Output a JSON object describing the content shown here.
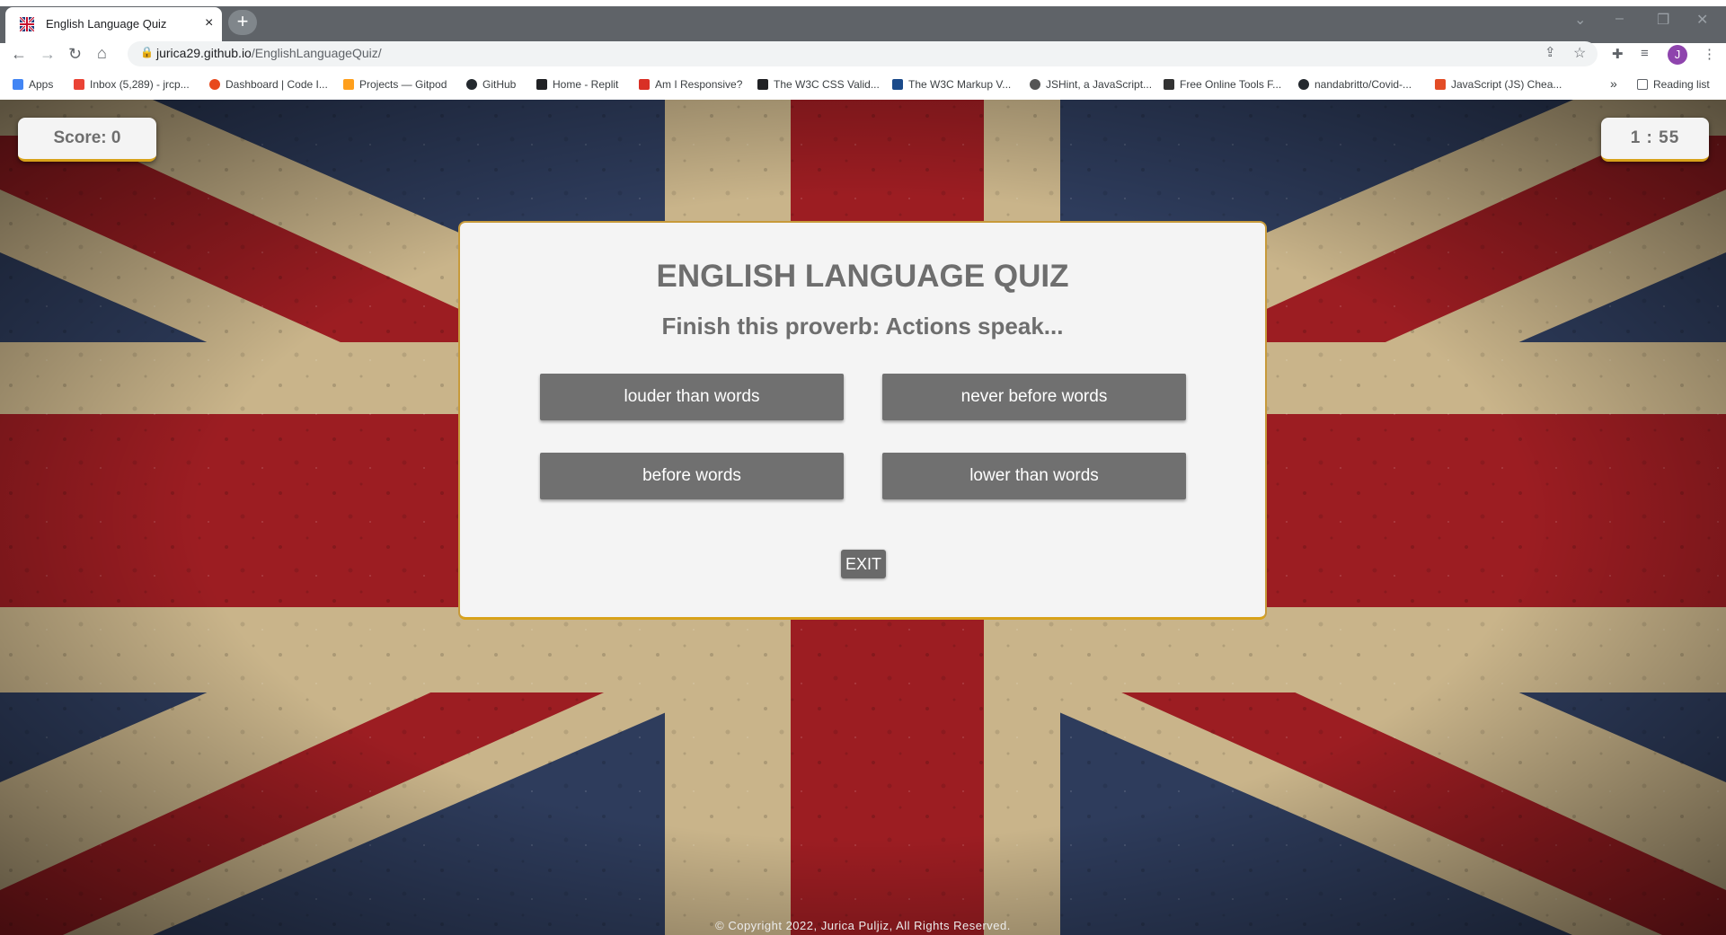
{
  "browser": {
    "tab_title": "English Language Quiz",
    "tab_close": "×",
    "new_tab": "+",
    "url_host": "jurica29.github.io",
    "url_path": "/EnglishLanguageQuiz/",
    "avatar_initial": "J",
    "bookmarks": [
      {
        "label": "Apps",
        "color": "#4285f4"
      },
      {
        "label": "Inbox (5,289) - jrcp...",
        "color": "#ea4335"
      },
      {
        "label": "Dashboard | Code I...",
        "color": "#e8491d"
      },
      {
        "label": "Projects — Gitpod",
        "color": "#ff9f1c"
      },
      {
        "label": "GitHub",
        "color": "#24292e"
      },
      {
        "label": "Home - Replit",
        "color": "#202124"
      },
      {
        "label": "Am I Responsive?",
        "color": "#d93025"
      },
      {
        "label": "The W3C CSS Valid...",
        "color": "#202124"
      },
      {
        "label": "The W3C Markup V...",
        "color": "#1a4a8a"
      },
      {
        "label": "JSHint, a JavaScript...",
        "color": "#555555"
      },
      {
        "label": "Free Online Tools F...",
        "color": "#333333"
      },
      {
        "label": "nandabritto/Covid-...",
        "color": "#24292e"
      },
      {
        "label": "JavaScript (JS) Chea...",
        "color": "#e34c26"
      }
    ],
    "bookmarks_overflow": "»",
    "reading_list": "Reading list"
  },
  "page": {
    "score_label": "Score: 0",
    "timer": "1 : 55",
    "quiz_title": "ENGLISH LANGUAGE QUIZ",
    "question": "Finish this proverb: Actions speak...",
    "answers": [
      "louder than words",
      "never before words",
      "before words",
      "lower than words"
    ],
    "exit_label": "EXIT",
    "footer": "© Copyright 2022, Jurica Puljiz, All Rights Reserved."
  },
  "colors": {
    "card_bg": "#f4f4f4",
    "button_bg": "#707070",
    "accent_border": "#d8a21a",
    "text_gray": "#6e6e6e"
  }
}
